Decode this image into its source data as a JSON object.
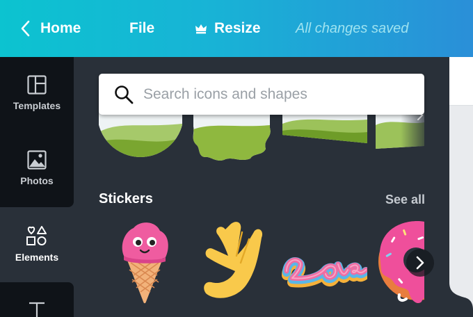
{
  "topbar": {
    "home_label": "Home",
    "file_label": "File",
    "resize_label": "Resize",
    "status": "All changes saved"
  },
  "sidebar": {
    "items": [
      {
        "label": "Templates",
        "icon": "templates-icon"
      },
      {
        "label": "Photos",
        "icon": "photos-icon"
      },
      {
        "label": "Elements",
        "icon": "elements-icon",
        "active": true
      },
      {
        "label": "",
        "icon": "text-icon"
      }
    ]
  },
  "search": {
    "placeholder": "Search icons and shapes"
  },
  "stickers": {
    "title": "Stickers",
    "see_all": "See all",
    "items": [
      "ice-cream-sticker",
      "waving-hand-sticker",
      "love-text-sticker",
      "donut-sticker"
    ]
  },
  "colors": {
    "topbar_start": "#0cc3d0",
    "topbar_end": "#2a8fd8",
    "panel": "#293039",
    "rail": "#0f1318"
  }
}
